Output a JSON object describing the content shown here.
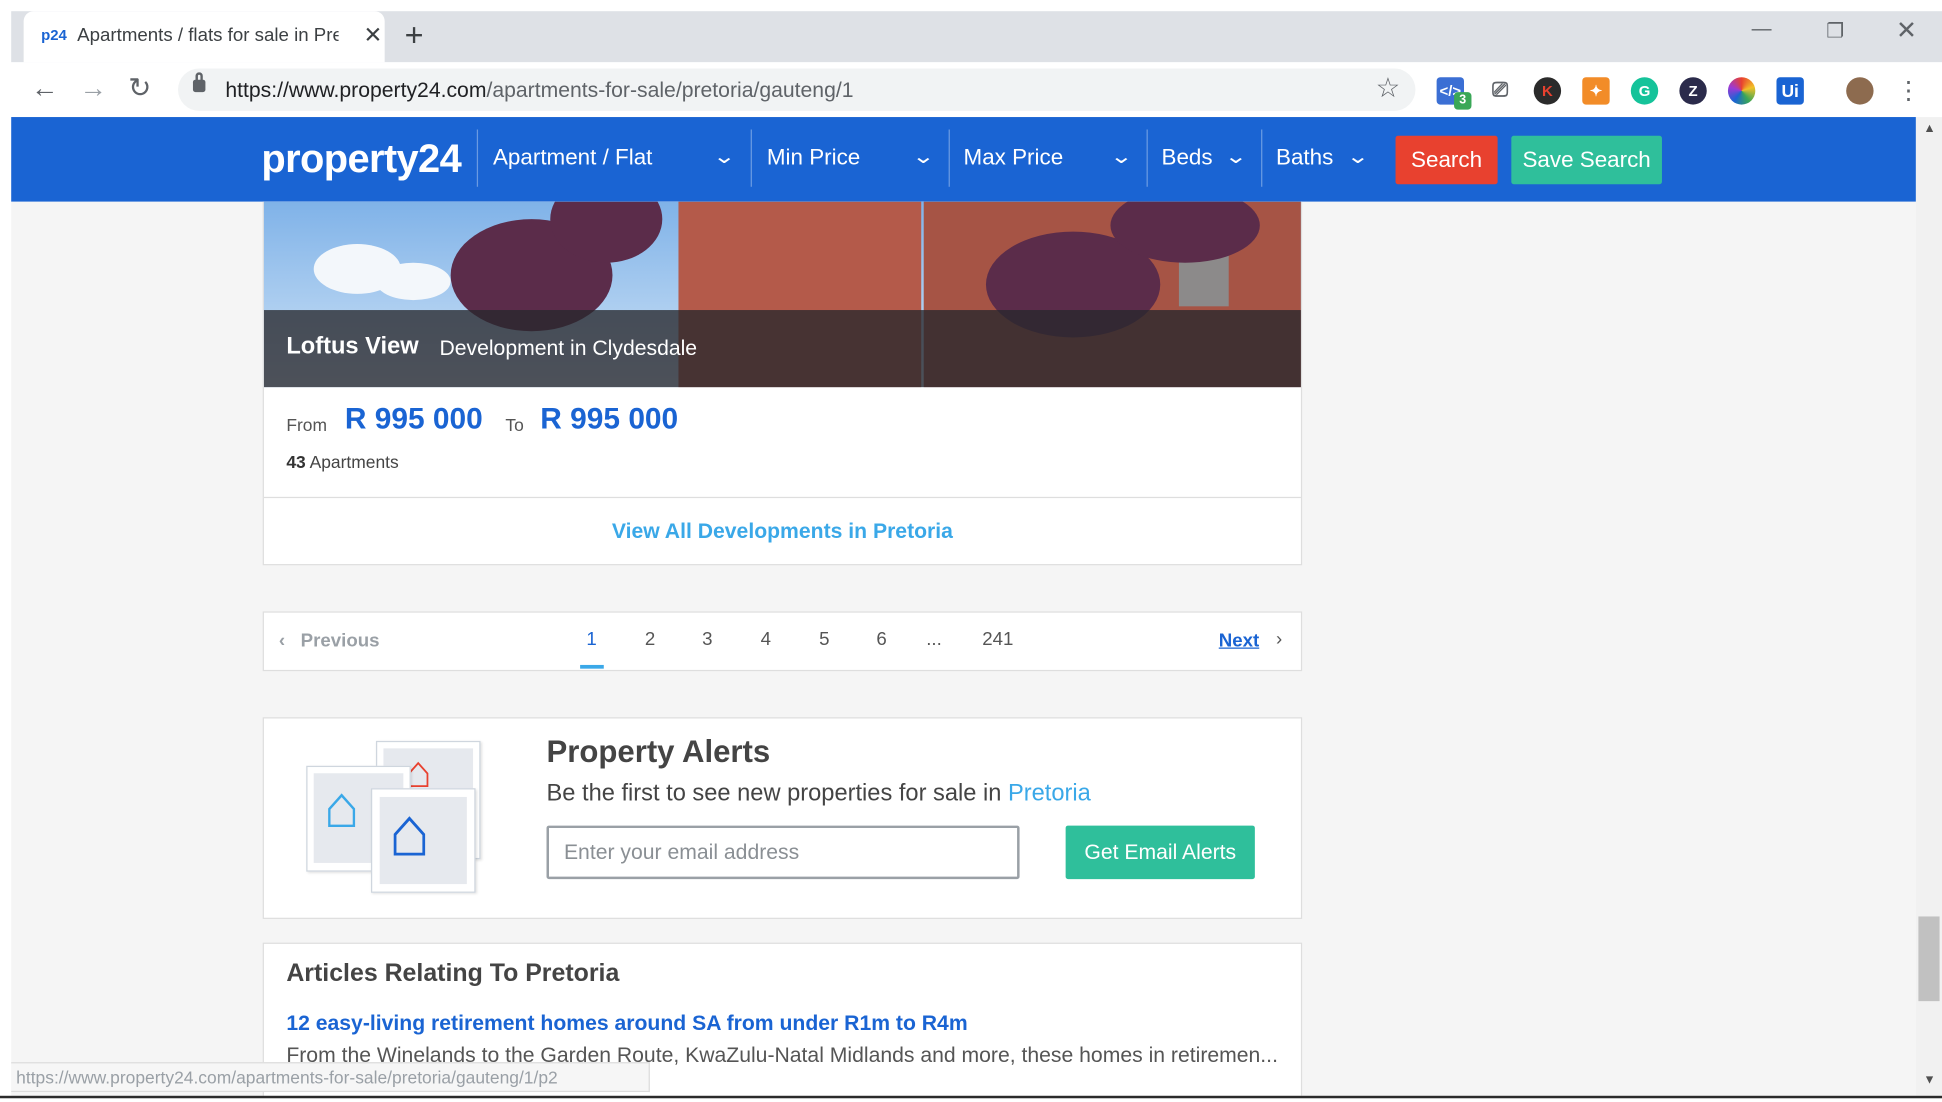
{
  "browser": {
    "tab_favicon": "p24",
    "tab_title": "Apartments / flats for sale in Pret",
    "new_tab_icon": "+",
    "url_host": "https://www.property24.com",
    "url_path": "/apartments-for-sale/pretoria/gauteng/1",
    "extension_badge": "3",
    "status_url": "https://www.property24.com/apartments-for-sale/pretoria/gauteng/1/p2"
  },
  "header": {
    "logo": "property24",
    "filters": {
      "property_type": "Apartment / Flat",
      "min_price": "Min Price",
      "max_price": "Max Price",
      "beds": "Beds",
      "baths": "Baths"
    },
    "search_label": "Search",
    "save_search_label": "Save Search",
    "colors": {
      "bar": "#1a64d3",
      "search": "#e8412f",
      "save": "#2fbf9b"
    }
  },
  "development": {
    "name": "Loftus View",
    "subtitle": "Development in Clydesdale",
    "from_label": "From",
    "from_price": "R 995 000",
    "to_label": "To",
    "to_price": "R 995 000",
    "unit_count": "43",
    "unit_label": " Apartments",
    "view_all_label": "View All Developments in Pretoria"
  },
  "pagination": {
    "previous_label": "Previous",
    "pages": [
      "1",
      "2",
      "3",
      "4",
      "5",
      "6",
      "...",
      "241"
    ],
    "current": "1",
    "next_label": "Next"
  },
  "alerts": {
    "title": "Property Alerts",
    "subtitle": "Be the first to see new properties for sale in ",
    "city": "Pretoria",
    "email_placeholder": "Enter your email address",
    "button_label": "Get Email Alerts"
  },
  "articles": {
    "heading": "Articles Relating To Pretoria",
    "items": [
      {
        "title": "12 easy-living retirement homes around SA from under R1m to R4m",
        "excerpt": "From the Winelands to the Garden Route, KwaZulu-Natal Midlands and more, these homes in retiremen..."
      }
    ]
  },
  "icons": {
    "back": "arrow-left-icon",
    "forward": "arrow-right-icon",
    "reload": "reload-icon",
    "lock": "lock-icon",
    "bookmark": "star-icon",
    "menu": "kebab-menu-icon"
  }
}
